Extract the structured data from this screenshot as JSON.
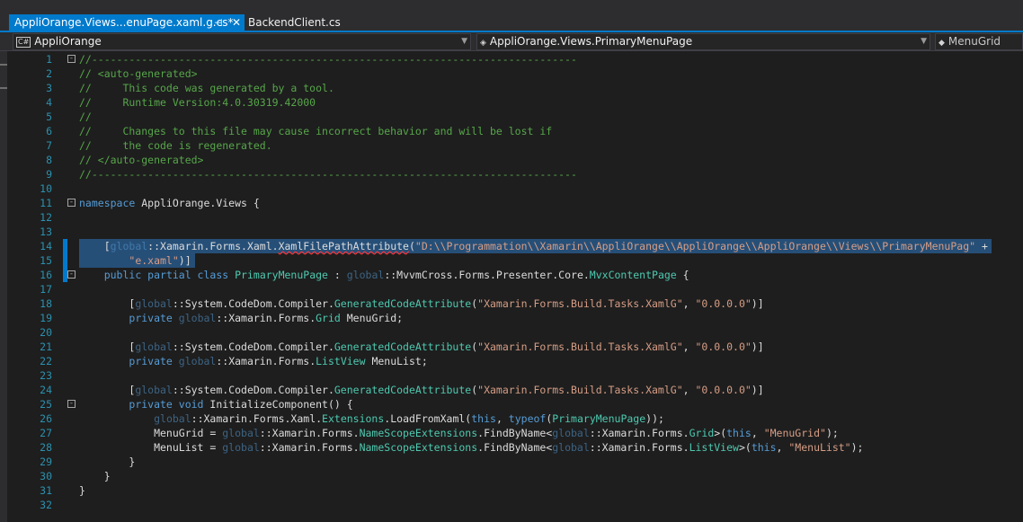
{
  "tabs": {
    "active_label": "AppliOrange.Views...enuPage.xaml.g.cs*",
    "pin_glyph": "⊣",
    "close_glyph": "✕",
    "inactive_label": "BackendClient.cs"
  },
  "navbar": {
    "project": "AppliOrange",
    "project_icon_text": "C#",
    "type": "AppliOrange.Views.PrimaryMenuPage",
    "member": "MenuGrid"
  },
  "colors": {
    "accent": "#007acc",
    "comment": "#57a64a",
    "keyword": "#569cd6",
    "type": "#4ec9b0",
    "string": "#d69d85",
    "line_number": "#2b91af",
    "selection": "#264f78"
  },
  "lines": [
    {
      "n": "1",
      "fold": "-",
      "tokens": [
        [
          "cm",
          "//------------------------------------------------------------------------------"
        ]
      ]
    },
    {
      "n": "2",
      "tokens": [
        [
          "cm",
          "// <auto-generated>"
        ]
      ]
    },
    {
      "n": "3",
      "tokens": [
        [
          "cm",
          "//     This code was generated by a tool."
        ]
      ]
    },
    {
      "n": "4",
      "tokens": [
        [
          "cm",
          "//     Runtime Version:4.0.30319.42000"
        ]
      ]
    },
    {
      "n": "5",
      "tokens": [
        [
          "cm",
          "//"
        ]
      ]
    },
    {
      "n": "6",
      "tokens": [
        [
          "cm",
          "//     Changes to this file may cause incorrect behavior and will be lost if"
        ]
      ]
    },
    {
      "n": "7",
      "tokens": [
        [
          "cm",
          "//     the code is regenerated."
        ]
      ]
    },
    {
      "n": "8",
      "tokens": [
        [
          "cm",
          "// </auto-generated>"
        ]
      ]
    },
    {
      "n": "9",
      "tokens": [
        [
          "cm",
          "//------------------------------------------------------------------------------"
        ]
      ]
    },
    {
      "n": "10",
      "tokens": []
    },
    {
      "n": "11",
      "fold": "-",
      "tokens": [
        [
          "kw",
          "namespace"
        ],
        [
          "id",
          " AppliOrange.Views {"
        ]
      ]
    },
    {
      "n": "12",
      "tokens": []
    },
    {
      "n": "13",
      "tokens": []
    },
    {
      "n": "14",
      "selected": true,
      "changed": true,
      "tokens": [
        [
          "id",
          "    ["
        ],
        [
          "gl",
          "global"
        ],
        [
          "id",
          "::Xamarin.Forms.Xaml."
        ],
        [
          "sq",
          "XamlFilePathAttribute"
        ],
        [
          "id",
          "("
        ],
        [
          "st",
          "\"D:\\\\Programmation\\\\Xamarin\\\\AppliOrange\\\\AppliOrange\\\\AppliOrange\\\\Views\\\\PrimaryMenuPag\""
        ],
        [
          "id",
          " +"
        ]
      ]
    },
    {
      "n": "15",
      "selected": true,
      "changed": true,
      "tokens": [
        [
          "id",
          "        "
        ],
        [
          "st",
          "\"e.xaml\""
        ],
        [
          "id",
          ")]"
        ]
      ]
    },
    {
      "n": "16",
      "fold": "-",
      "changed": true,
      "tokens": [
        [
          "id",
          "    "
        ],
        [
          "kw",
          "public partial class"
        ],
        [
          "id",
          " "
        ],
        [
          "ty",
          "PrimaryMenuPage"
        ],
        [
          "id",
          " : "
        ],
        [
          "gl",
          "global"
        ],
        [
          "id",
          "::MvvmCross.Forms.Presenter.Core."
        ],
        [
          "ty",
          "MvxContentPage"
        ],
        [
          "id",
          " {"
        ]
      ]
    },
    {
      "n": "17",
      "tokens": []
    },
    {
      "n": "18",
      "tokens": [
        [
          "id",
          "        ["
        ],
        [
          "gl",
          "global"
        ],
        [
          "id",
          "::System.CodeDom.Compiler."
        ],
        [
          "ty",
          "GeneratedCodeAttribute"
        ],
        [
          "id",
          "("
        ],
        [
          "st",
          "\"Xamarin.Forms.Build.Tasks.XamlG\""
        ],
        [
          "id",
          ", "
        ],
        [
          "st",
          "\"0.0.0.0\""
        ],
        [
          "id",
          ")]"
        ]
      ]
    },
    {
      "n": "19",
      "tokens": [
        [
          "id",
          "        "
        ],
        [
          "kw",
          "private"
        ],
        [
          "id",
          " "
        ],
        [
          "gl",
          "global"
        ],
        [
          "id",
          "::Xamarin.Forms."
        ],
        [
          "ty",
          "Grid"
        ],
        [
          "id",
          " MenuGrid;"
        ]
      ]
    },
    {
      "n": "20",
      "tokens": []
    },
    {
      "n": "21",
      "tokens": [
        [
          "id",
          "        ["
        ],
        [
          "gl",
          "global"
        ],
        [
          "id",
          "::System.CodeDom.Compiler."
        ],
        [
          "ty",
          "GeneratedCodeAttribute"
        ],
        [
          "id",
          "("
        ],
        [
          "st",
          "\"Xamarin.Forms.Build.Tasks.XamlG\""
        ],
        [
          "id",
          ", "
        ],
        [
          "st",
          "\"0.0.0.0\""
        ],
        [
          "id",
          ")]"
        ]
      ]
    },
    {
      "n": "22",
      "tokens": [
        [
          "id",
          "        "
        ],
        [
          "kw",
          "private"
        ],
        [
          "id",
          " "
        ],
        [
          "gl",
          "global"
        ],
        [
          "id",
          "::Xamarin.Forms."
        ],
        [
          "ty",
          "ListView"
        ],
        [
          "id",
          " MenuList;"
        ]
      ]
    },
    {
      "n": "23",
      "tokens": []
    },
    {
      "n": "24",
      "tokens": [
        [
          "id",
          "        ["
        ],
        [
          "gl",
          "global"
        ],
        [
          "id",
          "::System.CodeDom.Compiler."
        ],
        [
          "ty",
          "GeneratedCodeAttribute"
        ],
        [
          "id",
          "("
        ],
        [
          "st",
          "\"Xamarin.Forms.Build.Tasks.XamlG\""
        ],
        [
          "id",
          ", "
        ],
        [
          "st",
          "\"0.0.0.0\""
        ],
        [
          "id",
          ")]"
        ]
      ]
    },
    {
      "n": "25",
      "fold": "-",
      "tokens": [
        [
          "id",
          "        "
        ],
        [
          "kw",
          "private void"
        ],
        [
          "id",
          " InitializeComponent() {"
        ]
      ]
    },
    {
      "n": "26",
      "tokens": [
        [
          "id",
          "            "
        ],
        [
          "gl",
          "global"
        ],
        [
          "id",
          "::Xamarin.Forms.Xaml."
        ],
        [
          "ty",
          "Extensions"
        ],
        [
          "id",
          ".LoadFromXaml("
        ],
        [
          "kw",
          "this"
        ],
        [
          "id",
          ", "
        ],
        [
          "kw",
          "typeof"
        ],
        [
          "id",
          "("
        ],
        [
          "ty",
          "PrimaryMenuPage"
        ],
        [
          "id",
          "));"
        ]
      ]
    },
    {
      "n": "27",
      "tokens": [
        [
          "id",
          "            MenuGrid = "
        ],
        [
          "gl",
          "global"
        ],
        [
          "id",
          "::Xamarin.Forms."
        ],
        [
          "ty",
          "NameScopeExtensions"
        ],
        [
          "id",
          ".FindByName<"
        ],
        [
          "gl",
          "global"
        ],
        [
          "id",
          "::Xamarin.Forms."
        ],
        [
          "ty",
          "Grid"
        ],
        [
          "id",
          ">("
        ],
        [
          "kw",
          "this"
        ],
        [
          "id",
          ", "
        ],
        [
          "st",
          "\"MenuGrid\""
        ],
        [
          "id",
          ");"
        ]
      ]
    },
    {
      "n": "28",
      "tokens": [
        [
          "id",
          "            MenuList = "
        ],
        [
          "gl",
          "global"
        ],
        [
          "id",
          "::Xamarin.Forms."
        ],
        [
          "ty",
          "NameScopeExtensions"
        ],
        [
          "id",
          ".FindByName<"
        ],
        [
          "gl",
          "global"
        ],
        [
          "id",
          "::Xamarin.Forms."
        ],
        [
          "ty",
          "ListView"
        ],
        [
          "id",
          ">("
        ],
        [
          "kw",
          "this"
        ],
        [
          "id",
          ", "
        ],
        [
          "st",
          "\"MenuList\""
        ],
        [
          "id",
          ");"
        ]
      ]
    },
    {
      "n": "29",
      "tokens": [
        [
          "id",
          "        }"
        ]
      ]
    },
    {
      "n": "30",
      "tokens": [
        [
          "id",
          "    }"
        ]
      ]
    },
    {
      "n": "31",
      "tokens": [
        [
          "id",
          "}"
        ]
      ]
    },
    {
      "n": "32",
      "tokens": []
    }
  ]
}
